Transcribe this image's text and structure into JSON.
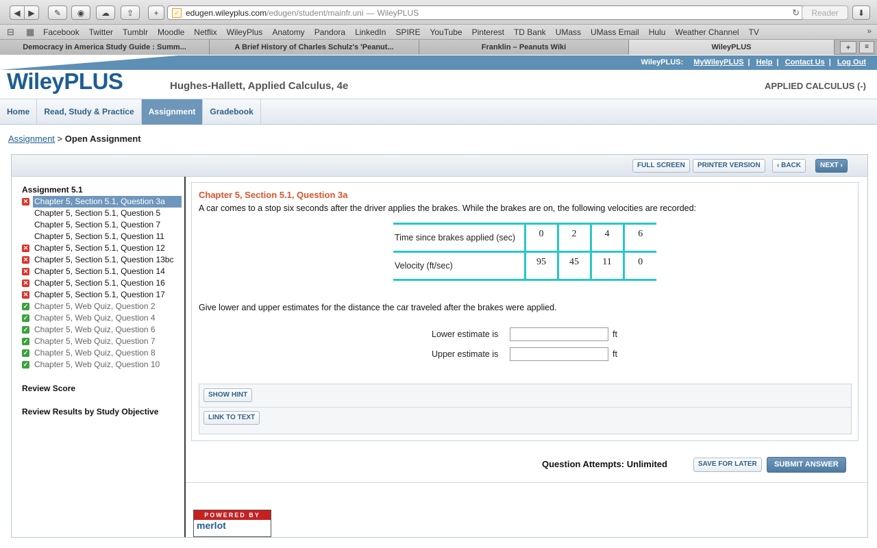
{
  "browser": {
    "url_host": "edugen.wileyplus.com",
    "url_path": "/edugen/student/mainfr.uni",
    "url_separator": "—",
    "page_title": "WileyPLUS",
    "reader_label": "Reader",
    "bookmarks": [
      "Facebook",
      "Twitter",
      "Tumblr",
      "Moodle",
      "Netflix",
      "WileyPlus",
      "Anatomy",
      "Pandora",
      "LinkedIn",
      "SPIRE",
      "YouTube",
      "Pinterest",
      "TD Bank",
      "UMass",
      "UMass Email",
      "Hulu",
      "Weather Channel",
      "TV"
    ],
    "tabs": [
      {
        "label": "Democracy in America Study Guide : Summ..."
      },
      {
        "label": "A Brief History of Charles Schulz's 'Peanut..."
      },
      {
        "label": "Franklin – Peanuts Wiki"
      },
      {
        "label": "WileyPLUS"
      }
    ]
  },
  "header": {
    "toplinks_prefix": "WileyPLUS:",
    "toplinks": [
      "MyWileyPLUS",
      "Help",
      "Contact Us",
      "Log Out"
    ],
    "brand": "WileyPLUS",
    "book_title": "Hughes-Hallett, Applied Calculus, 4e",
    "course_title": "APPLIED CALCULUS (-)"
  },
  "nav": [
    "Home",
    "Read, Study & Practice",
    "Assignment",
    "Gradebook"
  ],
  "breadcrumb": {
    "link": "Assignment",
    "sep": ">",
    "current": "Open Assignment"
  },
  "panel_buttons": {
    "full_screen": "FULL SCREEN",
    "printer": "PRINTER VERSION",
    "back": "‹ BACK",
    "next": "NEXT ›"
  },
  "sidebar": {
    "title": "Assignment 5.1",
    "questions": [
      {
        "label": "Chapter 5, Section 5.1, Question 3a",
        "status": "wrong"
      },
      {
        "label": "Chapter 5, Section 5.1, Question 5",
        "status": "none"
      },
      {
        "label": "Chapter 5, Section 5.1, Question 7",
        "status": "none"
      },
      {
        "label": "Chapter 5, Section 5.1, Question 11",
        "status": "none"
      },
      {
        "label": "Chapter 5, Section 5.1, Question 12",
        "status": "wrong"
      },
      {
        "label": "Chapter 5, Section 5.1, Question 13bc",
        "status": "wrong"
      },
      {
        "label": "Chapter 5, Section 5.1, Question 14",
        "status": "wrong"
      },
      {
        "label": "Chapter 5, Section 5.1, Question 16",
        "status": "wrong"
      },
      {
        "label": "Chapter 5, Section 5.1, Question 17",
        "status": "wrong"
      },
      {
        "label": "Chapter 5, Web Quiz, Question 2",
        "status": "right"
      },
      {
        "label": "Chapter 5, Web Quiz, Question 4",
        "status": "right"
      },
      {
        "label": "Chapter 5, Web Quiz, Question 6",
        "status": "right"
      },
      {
        "label": "Chapter 5, Web Quiz, Question 7",
        "status": "right"
      },
      {
        "label": "Chapter 5, Web Quiz, Question 8",
        "status": "right"
      },
      {
        "label": "Chapter 5, Web Quiz, Question 10",
        "status": "right"
      }
    ],
    "review_score": "Review Score",
    "review_results": "Review Results by Study Objective"
  },
  "question": {
    "title": "Chapter 5, Section 5.1, Question 3a",
    "text": "A car comes to a stop six seconds after the driver applies the brakes. While the brakes are on, the following velocities are recorded:",
    "table": {
      "row1_label": "Time since brakes applied (sec)",
      "row1": [
        "0",
        "2",
        "4",
        "6"
      ],
      "row2_label": "Velocity (ft/sec)",
      "row2": [
        "95",
        "45",
        "11",
        "0"
      ]
    },
    "prompt": "Give lower and upper estimates for the distance the car traveled after the brakes were applied.",
    "lower_label": "Lower estimate is",
    "upper_label": "Upper estimate is",
    "lower_value": "",
    "upper_value": "",
    "unit": "ft"
  },
  "hint_buttons": {
    "show_hint": "SHOW HINT",
    "link_to_text": "LINK TO TEXT"
  },
  "footer_actions": {
    "attempts": "Question Attempts: Unlimited",
    "save": "SAVE FOR LATER",
    "submit": "SUBMIT ANSWER"
  },
  "powered": {
    "line1": "POWERED BY",
    "line2": "merlot"
  },
  "colors": {
    "accent": "#1d5d93",
    "nav_active": "#6d96b9",
    "question_title": "#d9532c",
    "table_border": "#28c7c7",
    "wrong": "#d8362b",
    "right": "#3ca13c"
  }
}
